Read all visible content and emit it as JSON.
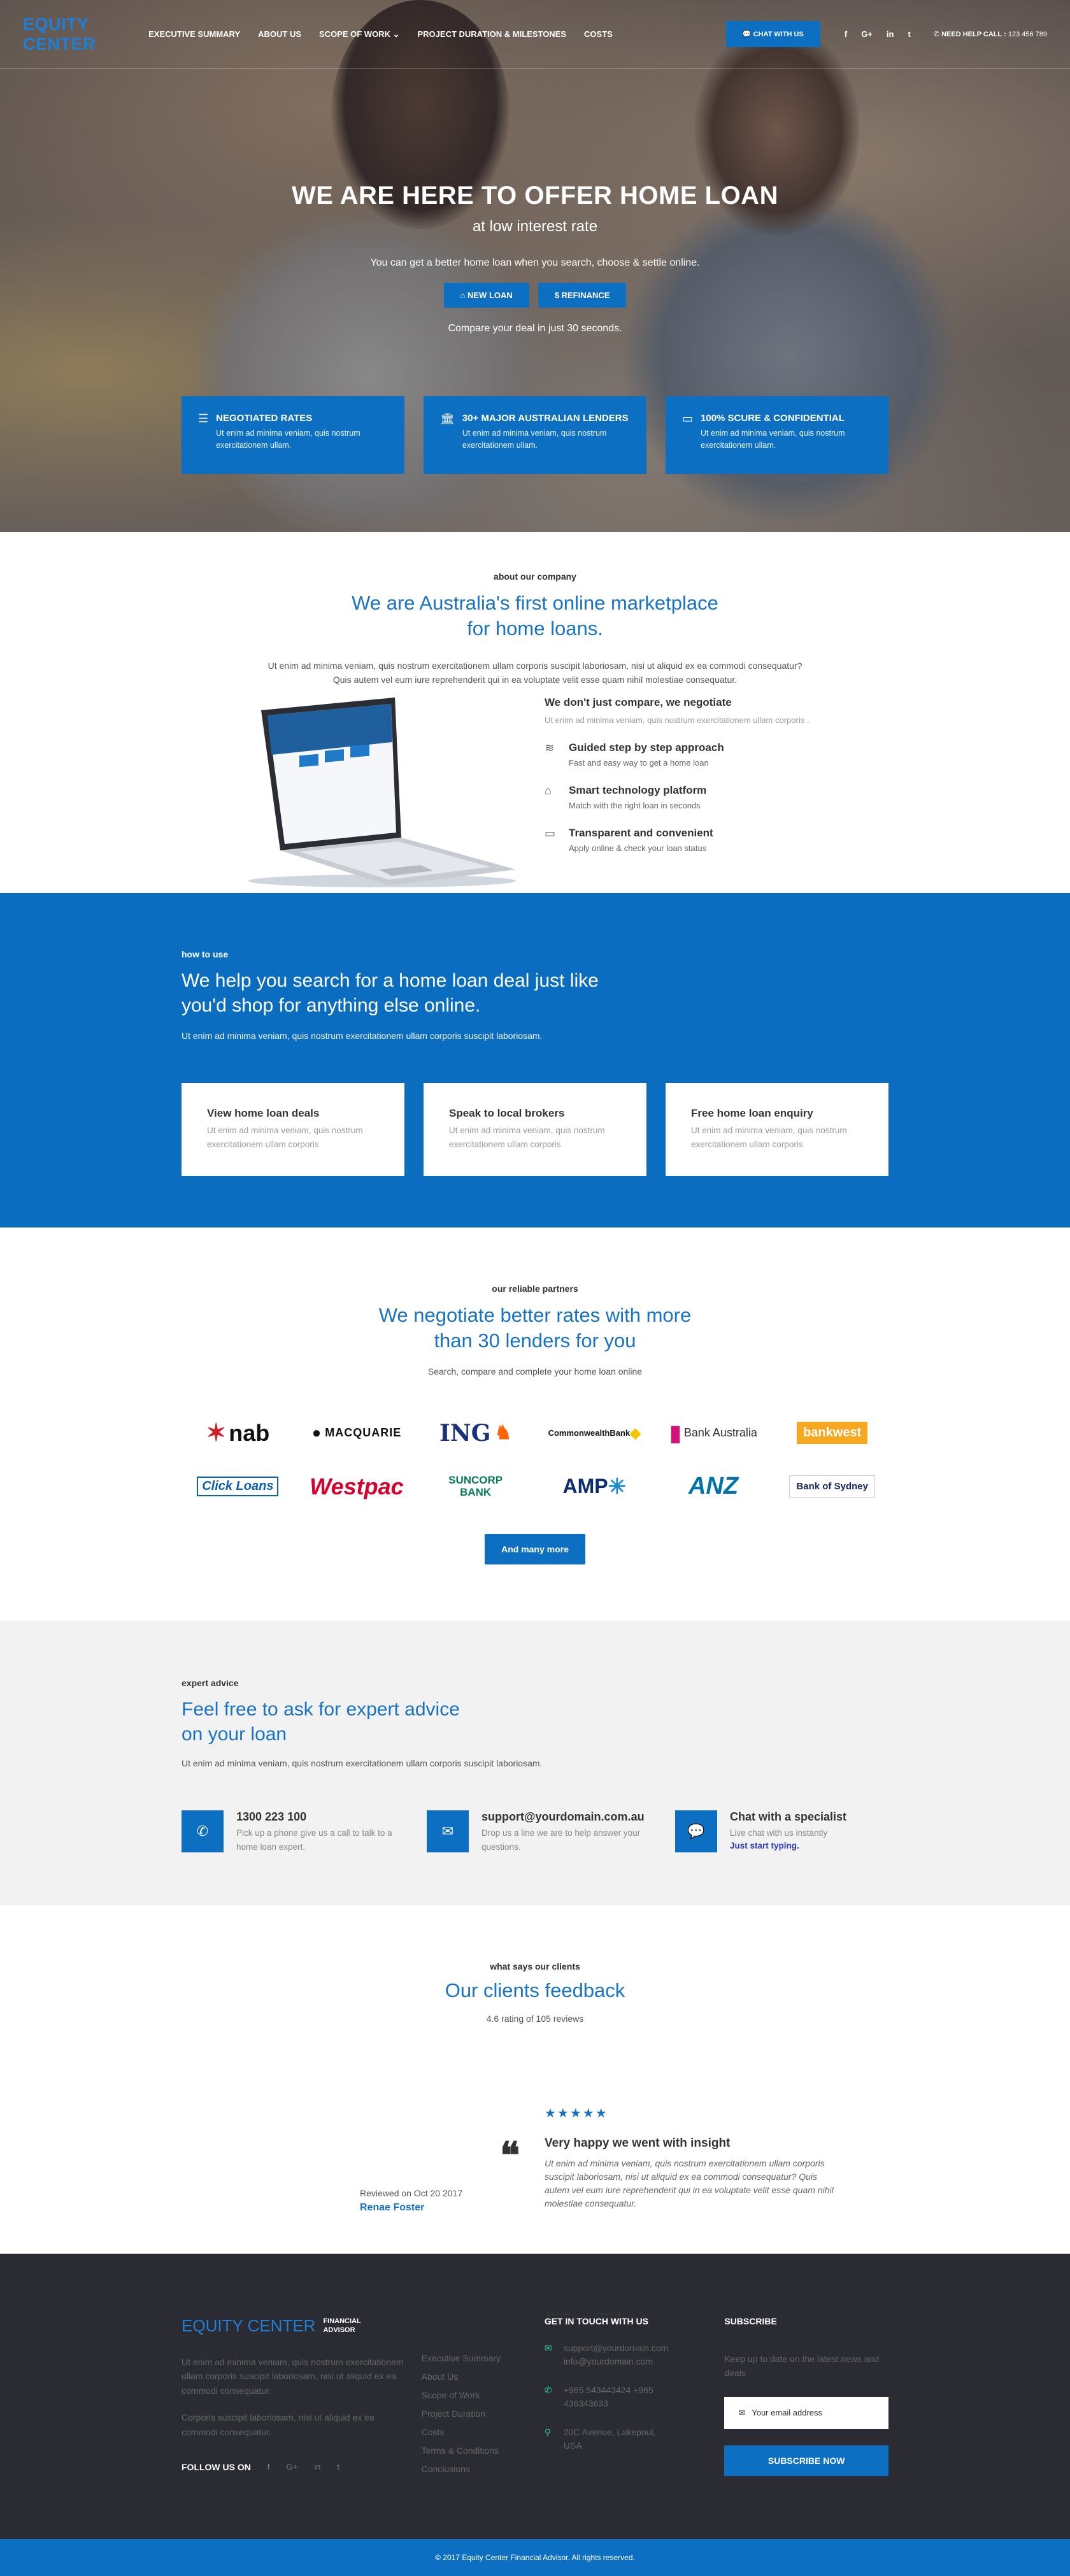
{
  "brand": {
    "name": "EQUITY CENTER",
    "accent": "#0d6fc2",
    "title_blue": "#1973c4"
  },
  "nav": {
    "items": [
      "EXECUTIVE SUMMARY",
      "ABOUT US",
      "SCOPE OF WORK",
      "PROJECT DURATION & MILESTONES",
      "COSTS"
    ],
    "chat": "CHAT WITH US",
    "social": [
      "f",
      "G+",
      "in",
      "t"
    ],
    "help_label": "NEED HELP CALL :",
    "help_number": "123 456 789"
  },
  "hero": {
    "title": "WE ARE HERE TO OFFER HOME LOAN",
    "subtitle": "at low interest rate",
    "lead": "You can get a better home loan when you search, choose & settle online.",
    "btn_new": "NEW LOAN",
    "btn_refinance": "$ REFINANCE",
    "compare": "Compare your deal in just 30 seconds.",
    "cards": [
      {
        "title": "NEGOTIATED RATES",
        "text": "Ut enim ad minima veniam, quis nostrum exercitationem ullam."
      },
      {
        "title": "30+ MAJOR AUSTRALIAN LENDERS",
        "text": "Ut enim ad minima veniam, quis nostrum exercitationem ullam."
      },
      {
        "title": "100% SCURE & CONFIDENTIAL",
        "text": "Ut enim ad minima veniam, quis nostrum exercitationem ullam."
      }
    ]
  },
  "about": {
    "kicker": "about our company",
    "title_1": "We are Australia's first online marketplace",
    "title_2": "for home loans.",
    "desc": "Ut enim ad minima veniam, quis nostrum exercitationem ullam corporis suscipit laboriosam, nisi ut aliquid ex ea commodi consequatur? Quis autem vel eum iure reprehenderit qui in ea voluptate velit esse quam nihil molestiae consequatur.",
    "heading": "We don't just compare, we negotiate",
    "intro": "Ut enim ad minima veniam, quis nostrum exercitationem ullam corporis .",
    "features": [
      {
        "title": "Guided step by step approach",
        "text": "Fast and easy way to get a home loan"
      },
      {
        "title": "Smart technology platform",
        "text": "Match with the right loan in seconds"
      },
      {
        "title": "Transparent and convenient",
        "text": "Apply online & check your loan status"
      }
    ]
  },
  "howto": {
    "kicker": "how to use",
    "title": "We help you search for a home loan deal just like you'd shop for anything else online.",
    "desc": "Ut enim ad minima veniam, quis nostrum exercitationem ullam corporis suscipit laboriosam.",
    "cards": [
      {
        "title": "View home loan deals",
        "text": "Ut enim ad minima veniam, quis nostrum exercitationem ullam corporis"
      },
      {
        "title": "Speak to local brokers",
        "text": "Ut enim ad minima veniam, quis nostrum exercitationem ullam corporis"
      },
      {
        "title": "Free home loan enquiry",
        "text": "Ut enim ad minima veniam, quis nostrum exercitationem ullam corporis"
      }
    ]
  },
  "partners": {
    "kicker": "our reliable partners",
    "title_1": "We negotiate better rates with more",
    "title_2": "than 30 lenders for you",
    "desc": "Search, compare and complete your home loan online",
    "logos": [
      "nab",
      "MACQUARIE",
      "ING",
      "CommonwealthBank",
      "Bank Australia",
      "bankwest",
      "Click Loans",
      "Westpac",
      "SUNCORP BANK",
      "AMP",
      "ANZ",
      "Bank of Sydney"
    ],
    "more": "And many more"
  },
  "expert": {
    "kicker": "expert advice",
    "title_1": "Feel free to ask for expert advice",
    "title_2": "on your loan",
    "desc": "Ut enim ad minima veniam, quis nostrum exercitationem ullam corporis suscipit laboriosam.",
    "contacts": [
      {
        "title": "1300 223 100",
        "text": "Pick up a phone give us a call to talk to a home loan expert."
      },
      {
        "title": "support@yourdomain.com.au",
        "text": "Drop us a line we are to help answer your questions."
      },
      {
        "title": "Chat with a specialist",
        "text": "Live chat with us instantly",
        "link": "Just start typing."
      }
    ]
  },
  "feedback": {
    "kicker": "what says our clients",
    "title": "Our clients feedback",
    "rating": "4.6 rating of 105 reviews",
    "stars": 5,
    "review_title": "Very happy we went with insight",
    "review_text": "Ut enim ad minima veniam, quis nostrum exercitationem ullam corporis suscipit laboriosam, nisi ut aliquid ex ea commodi consequatur? Quis autem vel eum iure reprehenderit qui in ea voluptate velit esse quam nihil molestiae consequatur.",
    "reviewed_on": "Reviewed on Oct 20 2017",
    "reviewer": "Renae Foster"
  },
  "footer": {
    "logo": "EQUITY CENTER",
    "logo_sub_1": "FINANCIAL",
    "logo_sub_2": "ADVISOR",
    "p1": "Ut enim ad minima veniam, quis nostrum exercitationem ullam corporis suscipit laboriosam, nisi ut aliquid ex ea commodi consequatur.",
    "p2": "Corporis suscipit laboriosam, nisi ut aliquid ex ea commodi consequatur.",
    "follow": "FOLLOW US ON",
    "links": [
      "Executive Summary",
      "About Us",
      "Scope of Work",
      "Project Duration",
      "Costs",
      "Terms & Conditions",
      "Conclusions"
    ],
    "touch_heading": "GET IN TOUCH WITH US",
    "emails": "support@yourdomain.com info@yourdomain.com",
    "phones": "+965 543443424 +965 436343633",
    "address": "20C Avenue, Lakepoul, USA",
    "subscribe_heading": "SUBSCRIBE",
    "subscribe_text": "Keep up to date on the latest news and deals",
    "email_placeholder": "Your email address",
    "subscribe_btn": "SUBSCRIBE NOW",
    "copyright": "© 2017 Equity Center Financial Advisor. All rights reserved."
  }
}
